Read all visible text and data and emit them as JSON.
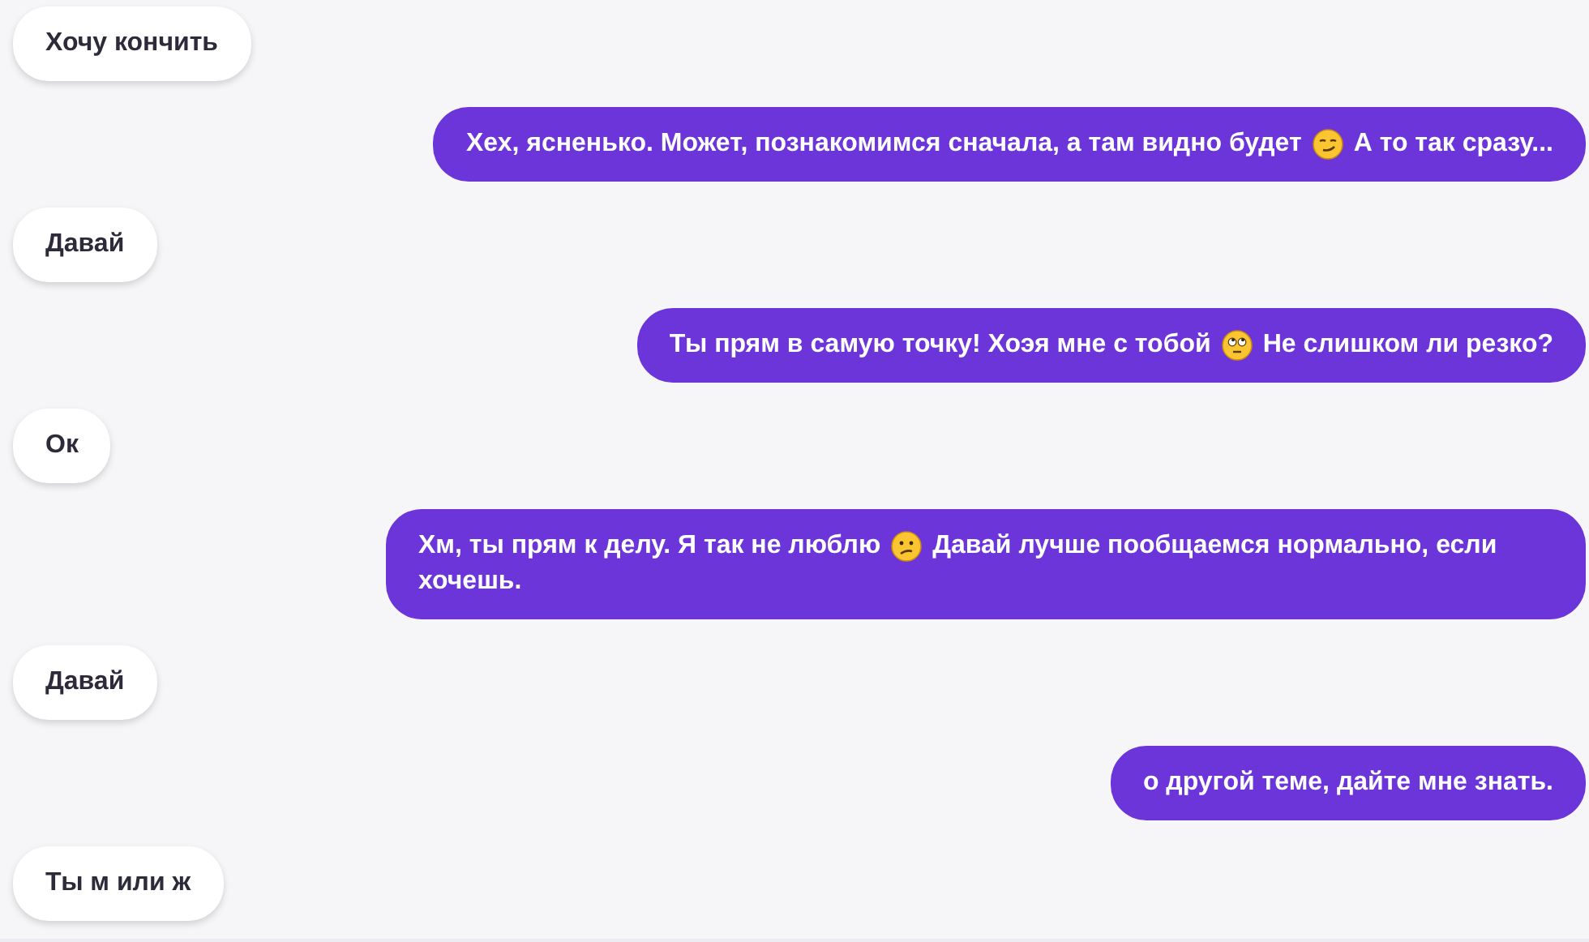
{
  "messages": [
    {
      "kind": "incoming",
      "parts": [
        {
          "kind": "text",
          "text": "Хочу кончить"
        }
      ]
    },
    {
      "kind": "outgoing",
      "parts": [
        {
          "kind": "text",
          "text": "Хех, ясненько. Может, познакомимся сначала, а там видно будет"
        },
        {
          "kind": "smirk"
        },
        {
          "kind": "text",
          "text": "А то так сразу..."
        }
      ]
    },
    {
      "kind": "incoming",
      "parts": [
        {
          "kind": "text",
          "text": "Давай"
        }
      ]
    },
    {
      "kind": "outgoing",
      "parts": [
        {
          "kind": "text",
          "text": "Ты прям в самую точку! Хоэя мне с тобой"
        },
        {
          "kind": "eyeroll"
        },
        {
          "kind": "text",
          "text": "Не слишком ли резко?"
        }
      ]
    },
    {
      "kind": "incoming",
      "parts": [
        {
          "kind": "text",
          "text": "Ок"
        }
      ]
    },
    {
      "kind": "outgoing",
      "parts": [
        {
          "kind": "text",
          "text": "Хм, ты прям к делу. Я так не люблю"
        },
        {
          "kind": "confused"
        },
        {
          "kind": "text",
          "text": "Давай лучше пообщаемся нормально, если"
        },
        {
          "kind": "text",
          "text": "хочешь."
        }
      ]
    },
    {
      "kind": "incoming",
      "parts": [
        {
          "kind": "text",
          "text": "Давай"
        }
      ]
    },
    {
      "kind": "outgoing",
      "parts": [
        {
          "kind": "text",
          "text": "о другой теме, дайте мне знать."
        }
      ]
    },
    {
      "kind": "incoming",
      "parts": [
        {
          "kind": "text",
          "text": "Ты м или ж"
        }
      ]
    }
  ]
}
